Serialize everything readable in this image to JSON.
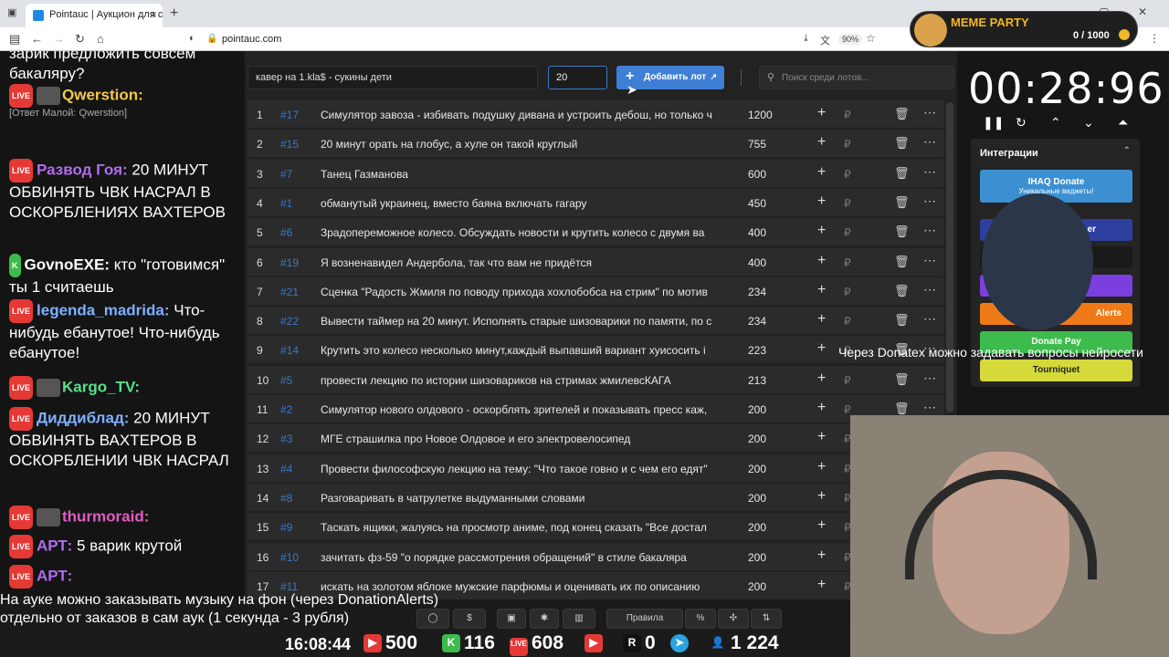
{
  "browser": {
    "tab_title": "Pointauc | Аукцион для стримов",
    "url": "pointauc.com",
    "zoom": "90%"
  },
  "chat": {
    "lines": [
      {
        "text": "зарик предложить совсем бакаляру?"
      },
      {
        "nick": "Qwerstion:",
        "nick_color": "#f2c94c",
        "text": ""
      },
      {
        "reply": "[Ответ Малой: Qwerstion]"
      },
      {
        "nick": "Развод Гоя:",
        "nick_color": "#b06cf0",
        "text": "20 МИНУТ ОБВИНЯТЬ ЧВК НАСРАЛ В ОСКОРБЛЕНИЯХ ВАХТЕРОВ"
      },
      {
        "nick": "GovnoEXE:",
        "nick_color": "#ffffff",
        "text": "кто \"готовимся\" ты 1 считаешь"
      },
      {
        "nick": "legenda_madrida:",
        "nick_color": "#7fb0ff",
        "text": "Что-нибудь ебанутое! Что-нибудь ебанутое!"
      },
      {
        "nick": "Kargo_TV:",
        "nick_color": "#58e08a",
        "text": ""
      },
      {
        "nick": "Диддиблад:",
        "nick_color": "#7fb0ff",
        "text": "20 МИНУТ ОБВИНЯТЬ ВАХТЕРОВ В ОСКОРБЛЕНИИ ЧВК НАСРАЛ"
      },
      {
        "nick": "thurmoraid:",
        "nick_color": "#e05cc0",
        "text": ""
      },
      {
        "nick": "АРТ:",
        "nick_color": "#b06cf0",
        "text": "5 варик крутой"
      },
      {
        "nick": "АРТ:",
        "nick_color": "#b06cf0",
        "text": ""
      }
    ],
    "live_label": "LIVE"
  },
  "form": {
    "lot_name": "кавер на 1.kla$ - сукины дети",
    "amount": "20",
    "add_button": "Добавить лот",
    "search_placeholder": "Поиск среди лотов..."
  },
  "lots": [
    {
      "idx": "1",
      "id": "#17",
      "name": "Симулятор завоза - избивать подушку дивана и устроить дебош, но только ч",
      "sum": "1200"
    },
    {
      "idx": "2",
      "id": "#15",
      "name": "20 минут орать на глобус, а хуле он такой круглый",
      "sum": "755"
    },
    {
      "idx": "3",
      "id": "#7",
      "name": "Танец Газманова",
      "sum": "600"
    },
    {
      "idx": "4",
      "id": "#1",
      "name": "обманутый украинец, вместо баяна включать гагару",
      "sum": "450"
    },
    {
      "idx": "5",
      "id": "#6",
      "name": "Зрадопереможное колесо. Обсуждать новости и крутить колесо с двумя ва",
      "sum": "400"
    },
    {
      "idx": "6",
      "id": "#19",
      "name": "Я возненавидел Андербола, так что вам не придётся",
      "sum": "400"
    },
    {
      "idx": "7",
      "id": "#21",
      "name": "Сценка \"Радость Жмиля по поводу прихода хохлобобса на стрим\" по мотив",
      "sum": "234"
    },
    {
      "idx": "8",
      "id": "#22",
      "name": "Вывести таймер на 20 минут. Исполнять старые шизоварики по памяти, по с",
      "sum": "234"
    },
    {
      "idx": "9",
      "id": "#14",
      "name": "Крутить это колесо несколько минут,каждый выпавший вариант хуисосить і",
      "sum": "223"
    },
    {
      "idx": "10",
      "id": "#5",
      "name": "провести лекцию по истории шизовариков на стримах жмилевсКАГА",
      "sum": "213"
    },
    {
      "idx": "11",
      "id": "#2",
      "name": "Симулятор нового олдового - оскорблять зрителей и показывать пресс каж,",
      "sum": "200"
    },
    {
      "idx": "12",
      "id": "#3",
      "name": " МГЕ страшилка про Новое Олдовое и его электровелосипед",
      "sum": "200"
    },
    {
      "idx": "13",
      "id": "#4",
      "name": "Провести философскую лекцию на тему: \"Что такое говно и с чем его едят\"",
      "sum": "200"
    },
    {
      "idx": "14",
      "id": "#8",
      "name": "Разговаривать в чатрулетке выдуманными словами",
      "sum": "200"
    },
    {
      "idx": "15",
      "id": "#9",
      "name": "Таскать ящики, жалуясь на просмотр аниме, под конец сказать \"Все достал",
      "sum": "200"
    },
    {
      "idx": "16",
      "id": "#10",
      "name": "зачитать фз-59 \"о порядке рассмотрения обращений\" в стиле бакаляра",
      "sum": "200"
    },
    {
      "idx": "17",
      "id": "#11",
      "name": " искать на золотом яблоке мужские парфюмы и оценивать их по описанию",
      "sum": "200"
    }
  ],
  "currency_symbol": "₽",
  "meme": {
    "title": "MEME PARTY",
    "progress": "0 / 1000"
  },
  "timer": "00:28:96",
  "integrations": {
    "title": "Интеграции",
    "buttons": [
      {
        "label": "IHAQ Donate",
        "sub": "Уникальные виджеты!",
        "color": "#3c8fd0"
      },
      {
        "label": "er",
        "color": "#2e3fa0"
      },
      {
        "label": "",
        "color": "#1a1a1a"
      },
      {
        "label": "",
        "color": "#7b3fe0"
      },
      {
        "label": "Alerts",
        "color": "#f07a18"
      },
      {
        "label": "Donate Pay",
        "color": "#3dbb4c"
      },
      {
        "label": "Tourniquet",
        "color": "#d6d93a"
      }
    ]
  },
  "ticker": "Через Donatex можно задавать вопросы нейросети",
  "info_text_1": "На ауке можно заказывать музыку на фон (через DonationAlerts)",
  "info_text_2": "отдельно от заказов в сам аук (1 секунда - 3 рубля)",
  "footer": {
    "rules": "Правила",
    "percent": "%"
  },
  "stats": {
    "clock": "16:08:44",
    "youtube": "500",
    "kick": "116",
    "live": "608",
    "r": "0",
    "viewers": "1 224"
  }
}
